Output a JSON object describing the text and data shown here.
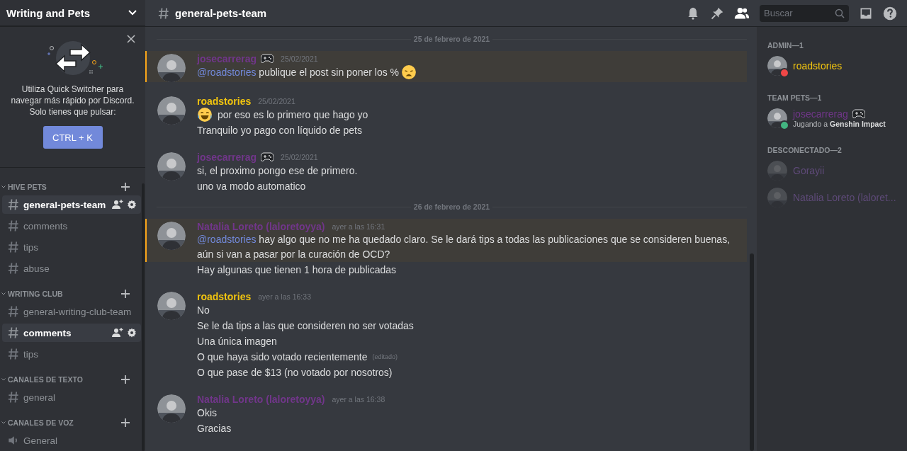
{
  "server": {
    "name": "Writing and Pets"
  },
  "quick_switcher": {
    "text": "Utiliza Quick Switcher para navegar más rápido por Discord. Solo tienes que pulsar:",
    "button": "CTRL + K"
  },
  "categories": [
    {
      "name": "HIVE PETS",
      "channels": [
        {
          "name": "general-pets-team",
          "kind": "text",
          "selected": true
        },
        {
          "name": "comments",
          "kind": "text",
          "selected": false
        },
        {
          "name": "tips",
          "kind": "text",
          "selected": false
        },
        {
          "name": "abuse",
          "kind": "text",
          "selected": false
        }
      ]
    },
    {
      "name": "WRITING CLUB",
      "channels": [
        {
          "name": "general-writing-club-team",
          "kind": "text",
          "selected": false
        },
        {
          "name": "comments",
          "kind": "text",
          "selected": true
        },
        {
          "name": "tips",
          "kind": "text",
          "selected": false
        }
      ]
    },
    {
      "name": "CANALES DE TEXTO",
      "channels": [
        {
          "name": "general",
          "kind": "text",
          "selected": false
        }
      ]
    },
    {
      "name": "CANALES DE VOZ",
      "channels": [
        {
          "name": "General",
          "kind": "voice",
          "selected": false
        }
      ]
    }
  ],
  "header": {
    "channel": "general-pets-team",
    "search_placeholder": "Buscar"
  },
  "chat": [
    {
      "kind": "divider",
      "text": "25 de febrero de 2021"
    },
    {
      "kind": "message",
      "author": "josecarrerag",
      "color": "#71368a",
      "playing": true,
      "time": "25/02/2021",
      "mentioned": true,
      "lines": [
        {
          "mention": "@roadstories",
          "text": " publique el post sin poner los %",
          "kind": "weary-after"
        }
      ]
    },
    {
      "kind": "message",
      "author": "roadstories",
      "color": "#f1c40f",
      "playing": false,
      "time": "25/02/2021",
      "mentioned": false,
      "lines": [
        {
          "text": " por eso es lo primero que hago yo",
          "kind": "laughing-before"
        },
        {
          "text": "Tranquilo yo pago con líquido de pets"
        }
      ]
    },
    {
      "kind": "message",
      "author": "josecarrerag",
      "color": "#71368a",
      "playing": true,
      "time": "25/02/2021",
      "mentioned": false,
      "lines": [
        {
          "text": "si, el proximo pongo ese de primero."
        },
        {
          "text": "uno va modo automatico"
        }
      ]
    },
    {
      "kind": "divider",
      "text": "26 de febrero de 2021"
    },
    {
      "kind": "message",
      "author": "Natalia Loreto (laloretoyya)",
      "color": "#71368a",
      "playing": false,
      "time": "ayer a las 16:31",
      "mentioned": true,
      "lines": [
        {
          "mention": "@roadstories",
          "text": " hay algo que no me ha quedado claro. Se le dará tips a todas las publicaciones que se consideren buenas, aún si van a pasar por la curación de OCD?"
        }
      ],
      "after": [
        {
          "text": "Hay algunas que tienen 1 hora de publicadas"
        }
      ]
    },
    {
      "kind": "message",
      "author": "roadstories",
      "color": "#f1c40f",
      "playing": false,
      "time": "ayer a las 16:33",
      "mentioned": false,
      "lines": [
        {
          "text": "No"
        },
        {
          "text": "Se le da tips a las que consideren no ser votadas"
        },
        {
          "text": "Una única imagen"
        },
        {
          "text": "O que haya sido votado recientemente",
          "edited": "(editado)"
        },
        {
          "text": "O que pase de $13 (no votado por nosotros)"
        }
      ]
    },
    {
      "kind": "message",
      "author": "Natalia Loreto (laloretoyya)",
      "color": "#71368a",
      "playing": false,
      "time": "ayer a las 16:38",
      "mentioned": false,
      "lines": [
        {
          "text": "Okis"
        },
        {
          "text": "Gracias"
        }
      ]
    }
  ],
  "members": [
    {
      "title": "ADMIN—1",
      "members": [
        {
          "name": "roadstories",
          "color": "#f1c40f",
          "kind": "dnd",
          "playing": false
        }
      ]
    },
    {
      "title": "TEAM PETS—1",
      "members": [
        {
          "name": "josecarrerag",
          "color": "#71368a",
          "kind": "online",
          "playing": true,
          "activity": "Jugando a **Genshin Impact**"
        }
      ]
    },
    {
      "title": "DESCONECTADO—2",
      "members": [
        {
          "name": "Gorayii",
          "color": "#5e4a78",
          "kind": "offline",
          "playing": false
        },
        {
          "name": "Natalia Loreto (laloret...",
          "color": "#5e4a78",
          "kind": "offline",
          "playing": false
        }
      ]
    }
  ]
}
